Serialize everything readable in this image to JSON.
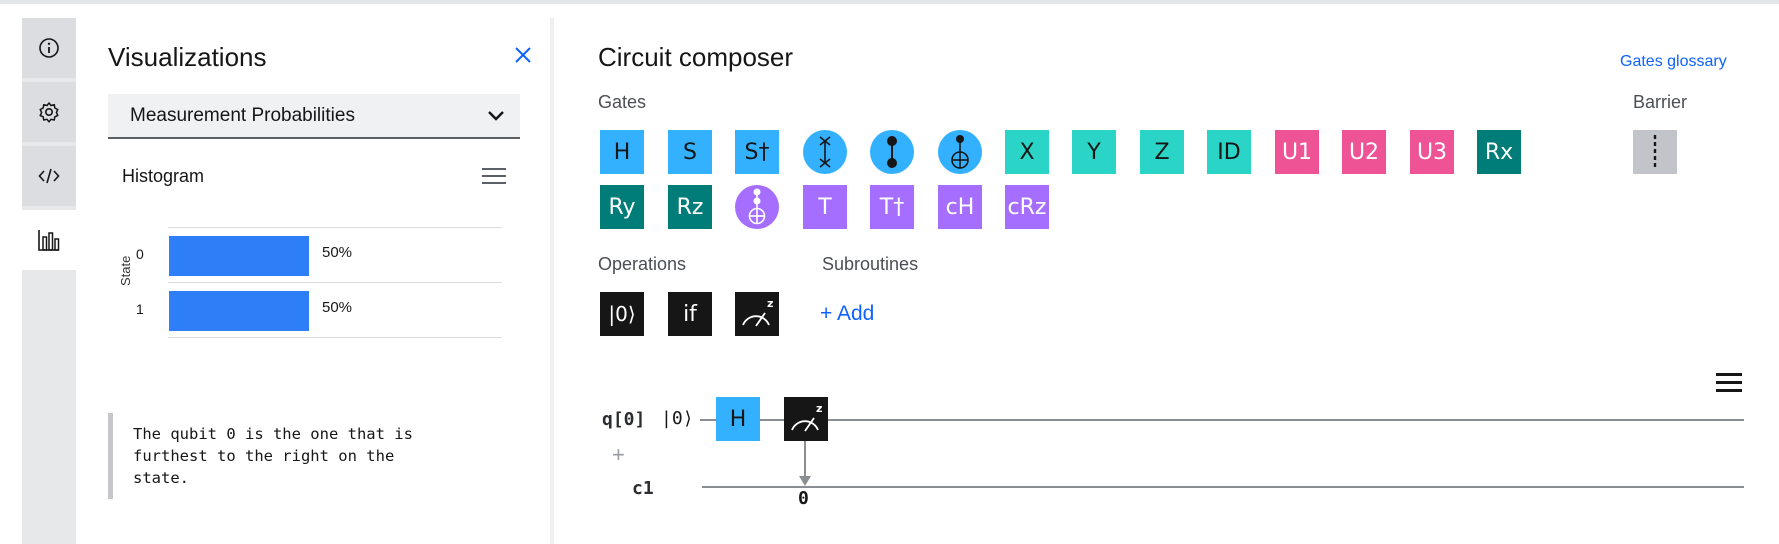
{
  "rail": {
    "items": [
      {
        "name": "info",
        "icon": "info-icon"
      },
      {
        "name": "settings",
        "icon": "gear-icon"
      },
      {
        "name": "code",
        "icon": "code-icon"
      },
      {
        "name": "visualizations",
        "icon": "bar-chart-icon",
        "active": true
      }
    ]
  },
  "visualizations": {
    "title": "Visualizations",
    "selected": "Measurement Probabilities",
    "chart_title": "Histogram",
    "note": "The qubit 0 is the one that is\nfurthest to the right on the\nstate."
  },
  "chart_data": {
    "type": "bar",
    "orientation": "horizontal",
    "title": "Histogram",
    "ylabel": "State",
    "xlabel": "",
    "categories": [
      "0",
      "1"
    ],
    "values": [
      50,
      50
    ],
    "value_labels": [
      "50%",
      "50%"
    ],
    "xlim": [
      0,
      100
    ],
    "color": "#2d7ef7"
  },
  "composer": {
    "title": "Circuit composer",
    "glossary_link": "Gates glossary",
    "gates_label": "Gates",
    "barrier_label": "Barrier",
    "operations_label": "Operations",
    "subroutines_label": "Subroutines",
    "add_label": "+ Add",
    "gates_row1": [
      "H",
      "S",
      "S†",
      "swap",
      "cz",
      "cnot",
      "X",
      "Y",
      "Z",
      "ID",
      "U1",
      "U2",
      "U3",
      "Rx"
    ],
    "gates_row2": [
      "Ry",
      "Rz",
      "ccx",
      "T",
      "T†",
      "cH",
      "cRz"
    ],
    "operations": [
      "|0⟩",
      "if",
      "measure"
    ]
  },
  "circuit": {
    "qubit_label": "q[0]",
    "qubit_init": "|0⟩",
    "classical_label": "c1",
    "gate_h": "H",
    "cbit_index": "0"
  },
  "colors": {
    "accent": "#0f62fe",
    "gate_blue": "#33b1ff",
    "gate_teal": "#2ad4c6",
    "gate_pink": "#ee5396",
    "gate_dark_teal": "#007d79",
    "gate_purple": "#a56eff",
    "gate_dark": "#161616"
  }
}
